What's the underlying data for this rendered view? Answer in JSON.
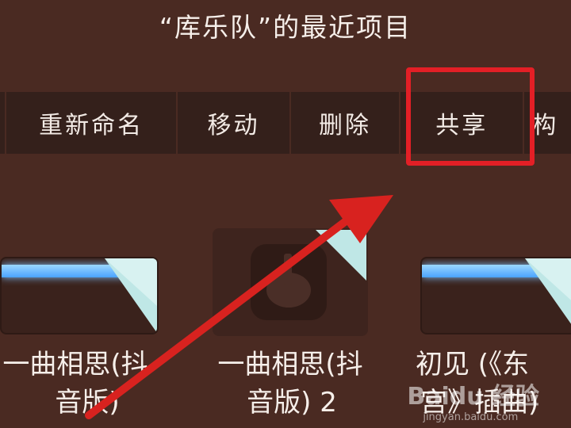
{
  "header": {
    "title": "“库乐队”的最近项目"
  },
  "menu": {
    "items": [
      {
        "label": ""
      },
      {
        "label": "重新命名"
      },
      {
        "label": "移动"
      },
      {
        "label": "删除"
      },
      {
        "label": "共享"
      },
      {
        "label": "构"
      }
    ]
  },
  "projects": [
    {
      "line1": "一曲相思(抖",
      "line2": "音版)"
    },
    {
      "line1": "一曲相思(抖",
      "line2": "音版) 2"
    },
    {
      "line1": "初见 (《东",
      "line2": "宫》插曲)"
    }
  ],
  "watermark": {
    "logo": "Baidu 经验",
    "url": "jingyan.baidu.com"
  },
  "colors": {
    "background": "#4a2a22",
    "menubar": "#34201b",
    "highlight": "#e31f26",
    "arrow": "#d8221f"
  }
}
